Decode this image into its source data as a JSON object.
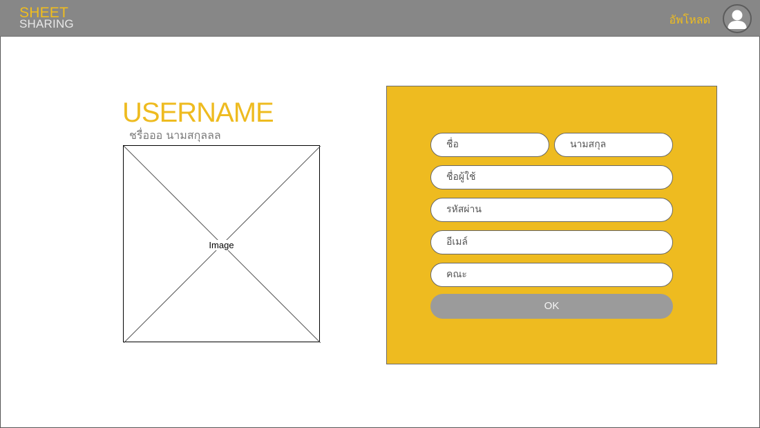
{
  "header": {
    "logo_line1": "SHEET",
    "logo_line2": "SHARING",
    "upload_label": "อัพโหลด",
    "avatar_icon": "user-avatar-icon"
  },
  "profile": {
    "username": "USERNAME",
    "fullname": "ชรื่อออ นามสกุลลล",
    "image_label": "Image"
  },
  "form": {
    "first_name_placeholder": "ชื่อ",
    "last_name_placeholder": "นามสกุล",
    "username_placeholder": "ชื่อผู้ใช้",
    "password_placeholder": "รหัสผ่าน",
    "email_placeholder": "อีเมล์",
    "faculty_placeholder": "คณะ",
    "ok_label": "OK"
  },
  "colors": {
    "accent": "#eebb20",
    "header_bg": "#878787",
    "button_bg": "#9b9b9b"
  }
}
